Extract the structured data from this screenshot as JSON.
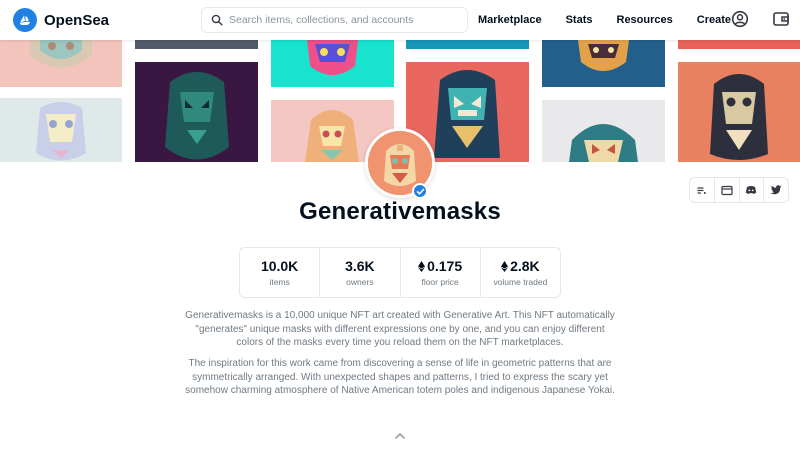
{
  "header": {
    "brand": "OpenSea",
    "search_placeholder": "Search items, collections, and accounts",
    "nav": [
      "Marketplace",
      "Stats",
      "Resources",
      "Create"
    ],
    "brand_color": "#2081e2"
  },
  "collection": {
    "name": "Generativemasks",
    "verified": true,
    "stats": [
      {
        "value": "10.0K",
        "label": "items",
        "eth": false
      },
      {
        "value": "3.6K",
        "label": "owners",
        "eth": false
      },
      {
        "value": "0.175",
        "label": "floor price",
        "eth": true
      },
      {
        "value": "2.8K",
        "label": "volume traded",
        "eth": true
      }
    ],
    "description_1": "Generativemasks is a 10,000 unique NFT art created with Generative Art. This NFT automatically \"generates\" unique masks with different expressions one by one, and you can enjoy different colors of the masks every time you reload them on the NFT marketplaces.",
    "description_2": "The inspiration for this work came from discovering a sense of life in geometric patterns that are symmetrically arranged. With unexpected shapes and patterns, I tried to express the scary yet somehow charming atmosphere of Native American totem poles and indigenous Japanese Yokai."
  },
  "icons": {
    "search": "search-icon",
    "account": "account-icon",
    "wallet": "wallet-icon",
    "social": [
      "activity-icon",
      "website-icon",
      "discord-icon",
      "twitter-icon"
    ],
    "expand": "chevron-up-icon"
  }
}
